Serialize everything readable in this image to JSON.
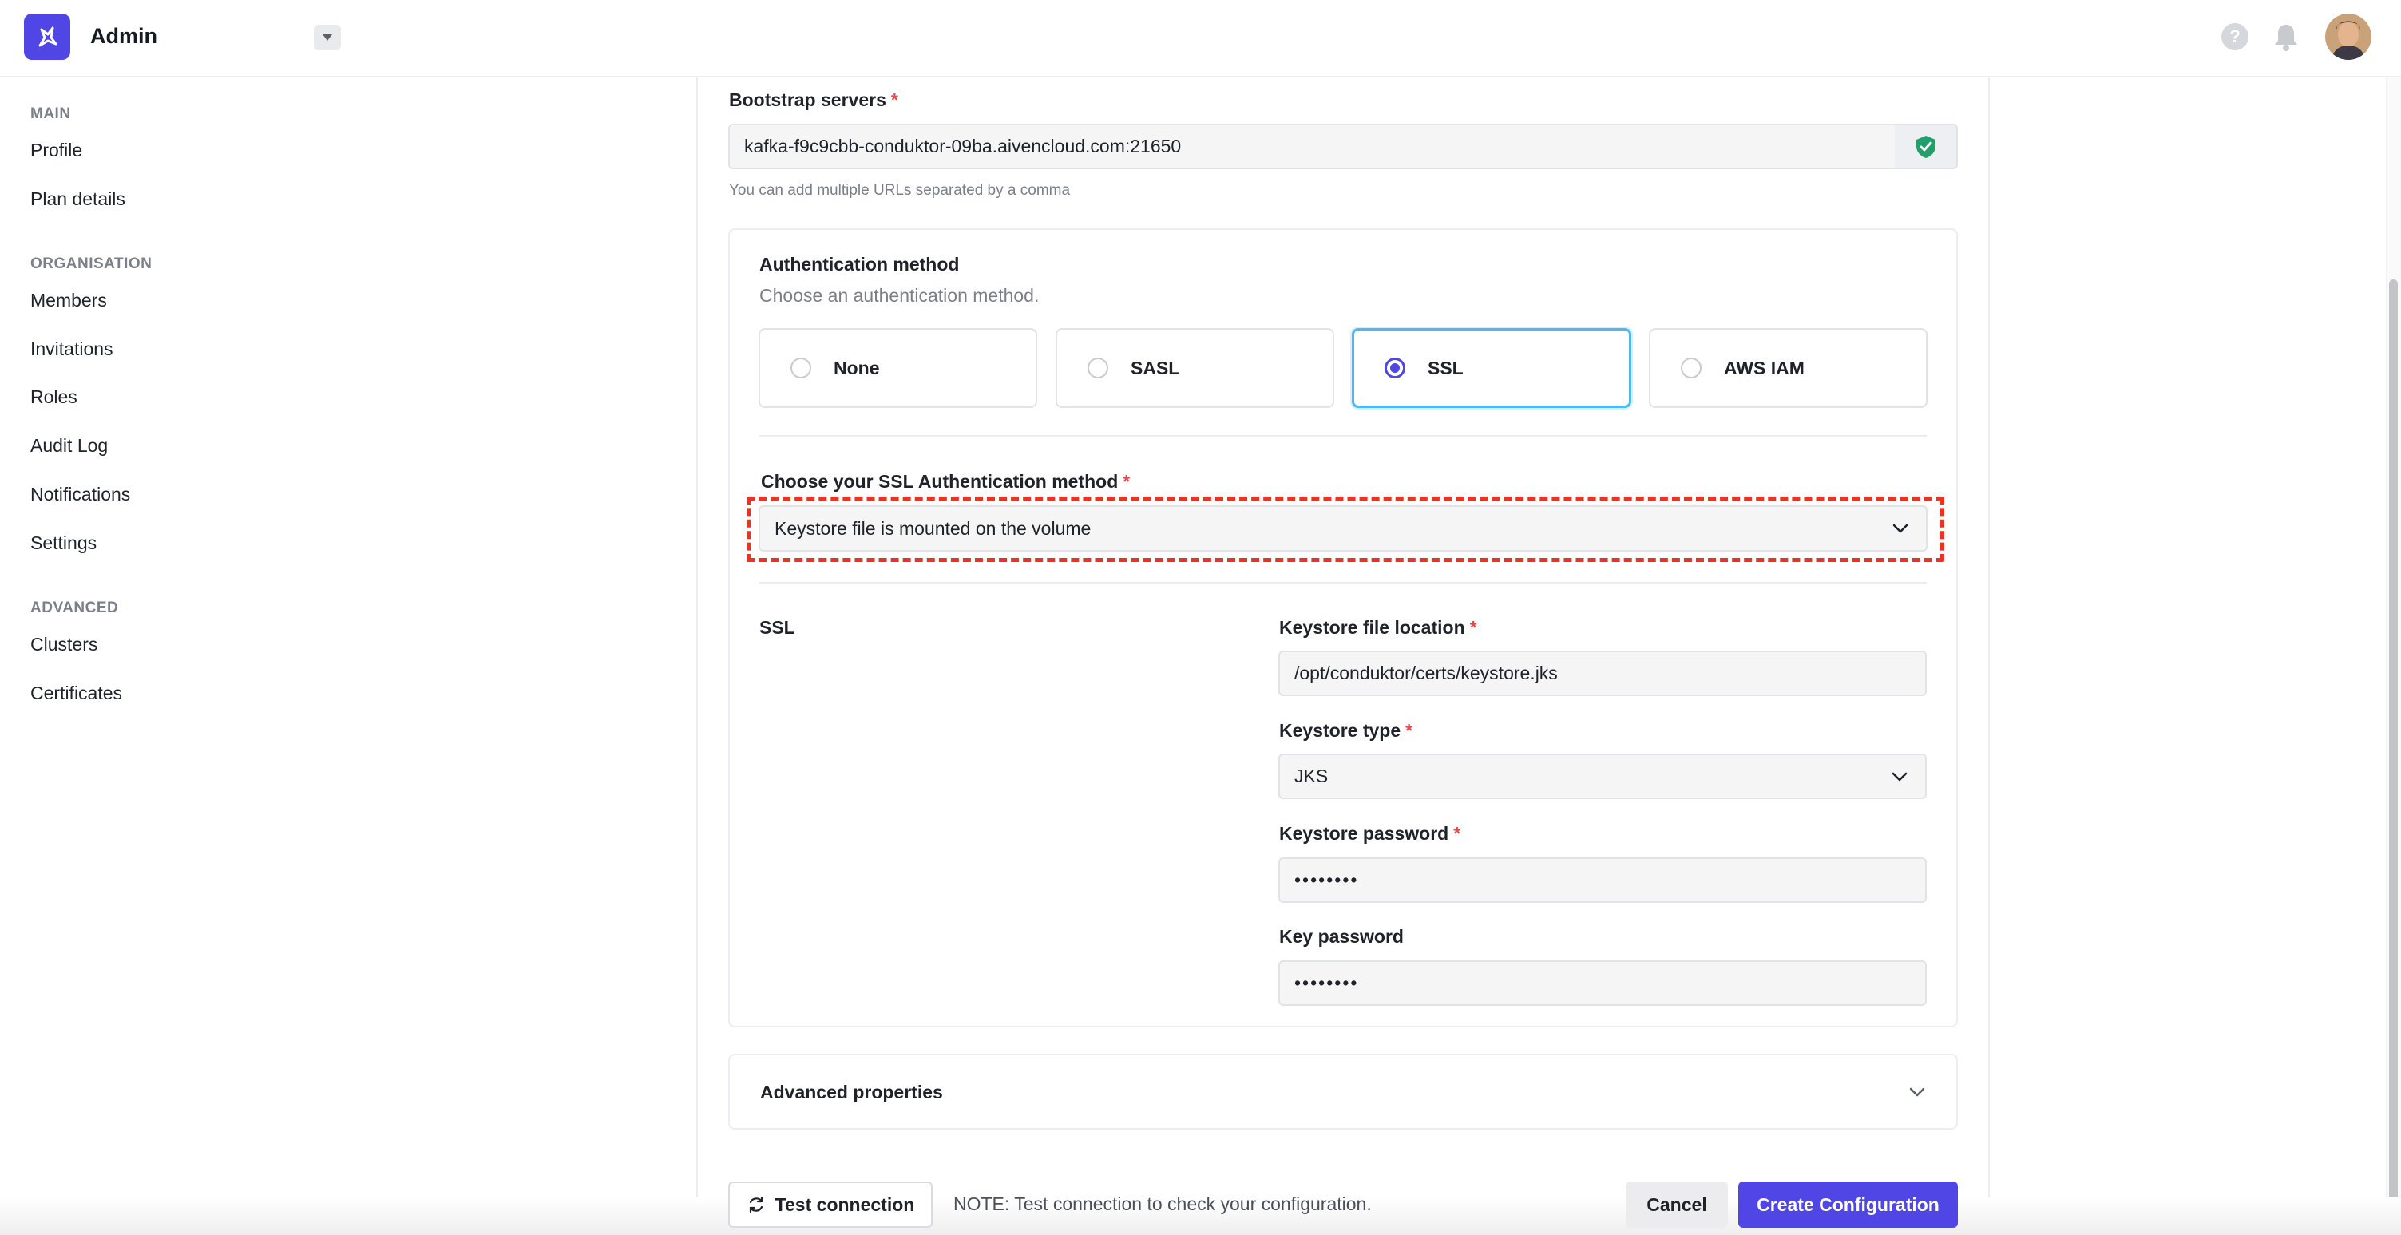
{
  "header": {
    "app_title": "Admin",
    "help_glyph": "?"
  },
  "sidebar": {
    "sections": [
      {
        "title": "MAIN",
        "items": [
          "Profile",
          "Plan details"
        ]
      },
      {
        "title": "ORGANISATION",
        "items": [
          "Members",
          "Invitations",
          "Roles",
          "Audit Log",
          "Notifications",
          "Settings"
        ]
      },
      {
        "title": "ADVANCED",
        "items": [
          "Clusters",
          "Certificates"
        ]
      }
    ]
  },
  "form": {
    "bootstrap": {
      "label": "Bootstrap servers",
      "required_mark": "*",
      "value": "kafka-f9c9cbb-conduktor-09ba.aivencloud.com:21650",
      "hint": "You can add multiple URLs separated by a comma"
    },
    "auth": {
      "title": "Authentication method",
      "subtitle": "Choose an authentication method.",
      "options": [
        "None",
        "SASL",
        "SSL",
        "AWS IAM"
      ],
      "selected": "SSL"
    },
    "ssl_method": {
      "label": "Choose your SSL Authentication method",
      "required_mark": "*",
      "value": "Keystore file is mounted on the volume"
    },
    "ssl_section": {
      "title": "SSL",
      "keystore_location": {
        "label": "Keystore file location",
        "required_mark": "*",
        "value": "/opt/conduktor/certs/keystore.jks"
      },
      "keystore_type": {
        "label": "Keystore type",
        "required_mark": "*",
        "value": "JKS"
      },
      "keystore_password": {
        "label": "Keystore password",
        "required_mark": "*",
        "value": "••••••••"
      },
      "key_password": {
        "label": "Key password",
        "value": "••••••••"
      }
    },
    "advanced": {
      "label": "Advanced properties"
    }
  },
  "footer": {
    "test_button": "Test connection",
    "note": "NOTE: Test connection to check your configuration.",
    "cancel_button": "Cancel",
    "create_button": "Create Configuration"
  },
  "colors": {
    "accent": "#4f46e5",
    "selected_border": "#4fb8f0",
    "required": "#e5484d",
    "highlight_dash": "#ea3323",
    "shield": "#22a06b"
  }
}
